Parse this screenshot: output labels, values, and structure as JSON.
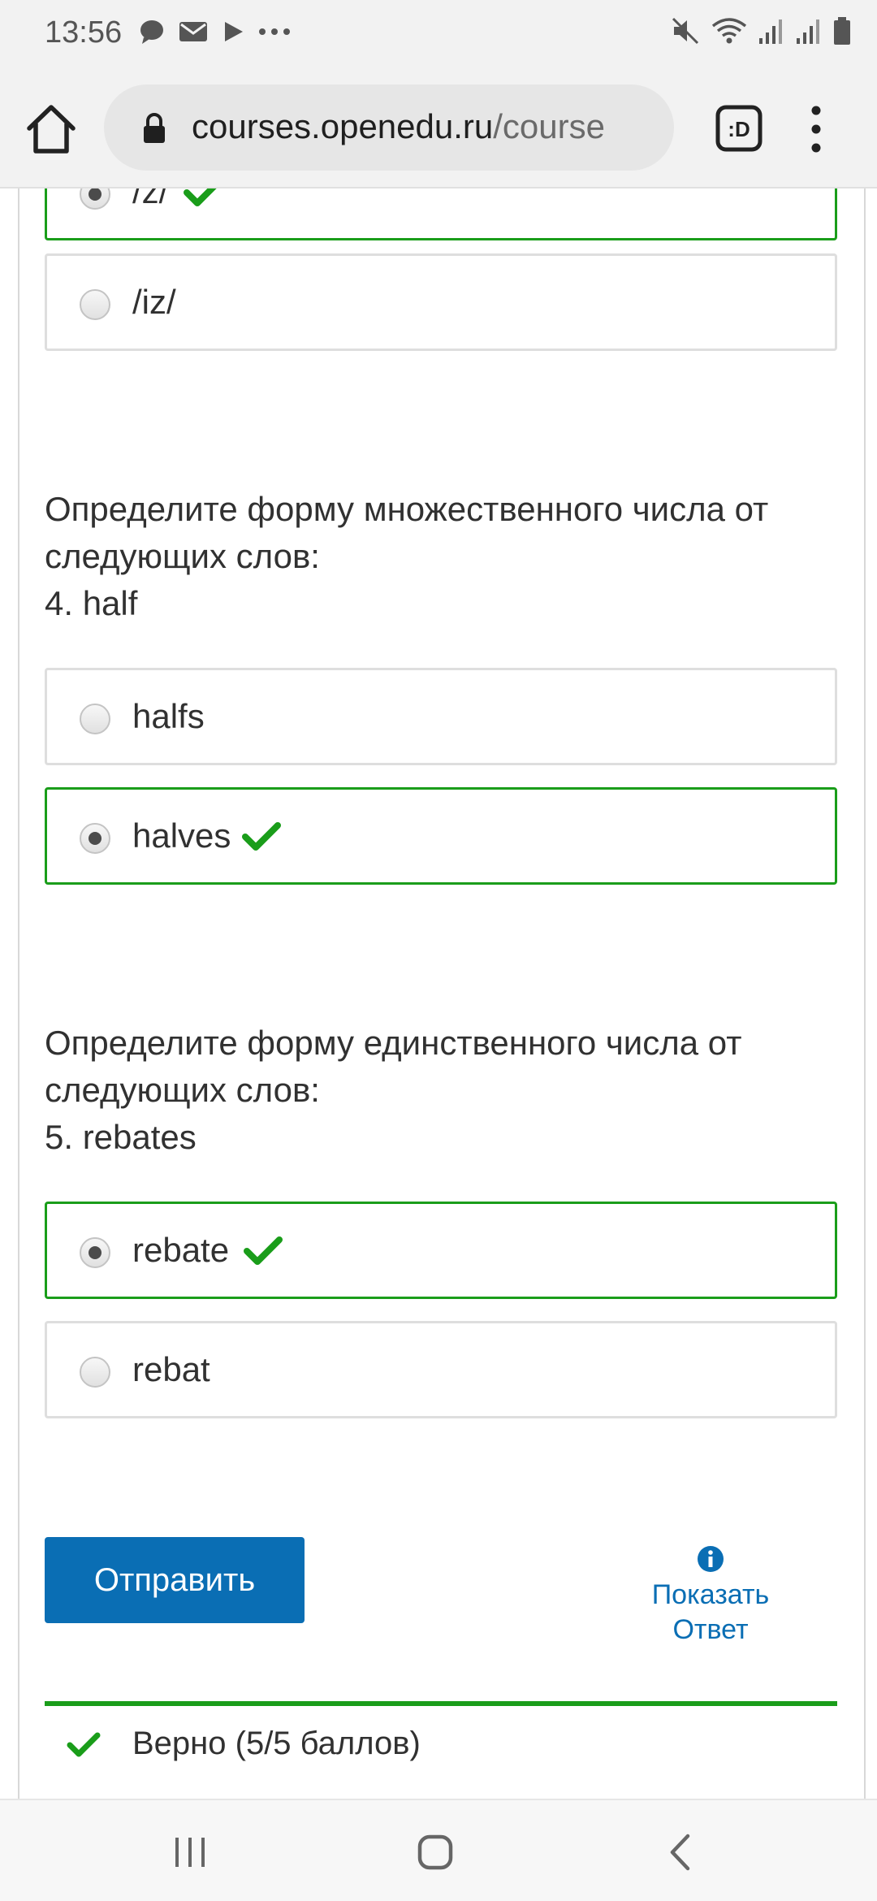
{
  "status_bar": {
    "time": "13:56",
    "left_icons": [
      "chat-bubble-icon",
      "mail-icon",
      "play-icon",
      "more-dots-icon"
    ],
    "right_icons": [
      "mute-icon",
      "wifi-icon",
      "signal-icon",
      "signal-icon",
      "battery-icon"
    ]
  },
  "browser": {
    "url_host": "courses.openedu.ru",
    "url_path": "/course",
    "tab_label": ":D"
  },
  "questions": [
    {
      "id": "q3",
      "prompt_lines": [],
      "options": [
        {
          "label": "/z/",
          "selected": true,
          "correct": true
        },
        {
          "label": "/iz/",
          "selected": false,
          "correct": false
        }
      ]
    },
    {
      "id": "q4",
      "prompt_lines": [
        "Определите форму множественного числа от",
        "следующих слов:",
        "4. half"
      ],
      "options": [
        {
          "label": "halfs",
          "selected": false,
          "correct": false
        },
        {
          "label": "halves",
          "selected": true,
          "correct": true
        }
      ]
    },
    {
      "id": "q5",
      "prompt_lines": [
        "Определите форму единственного числа от",
        "следующих слов:",
        "5. rebates"
      ],
      "options": [
        {
          "label": "rebate",
          "selected": true,
          "correct": true
        },
        {
          "label": "rebat",
          "selected": false,
          "correct": false
        }
      ]
    }
  ],
  "actions": {
    "submit_label": "Отправить",
    "show_answer_line1": "Показать",
    "show_answer_line2": "Ответ"
  },
  "result": {
    "text": "Верно (5/5 баллов)",
    "status": "correct"
  },
  "colors": {
    "correct_green": "#1a9d1a",
    "primary_blue": "#0a6eb4",
    "text": "#313131",
    "option_border": "#dedede"
  }
}
